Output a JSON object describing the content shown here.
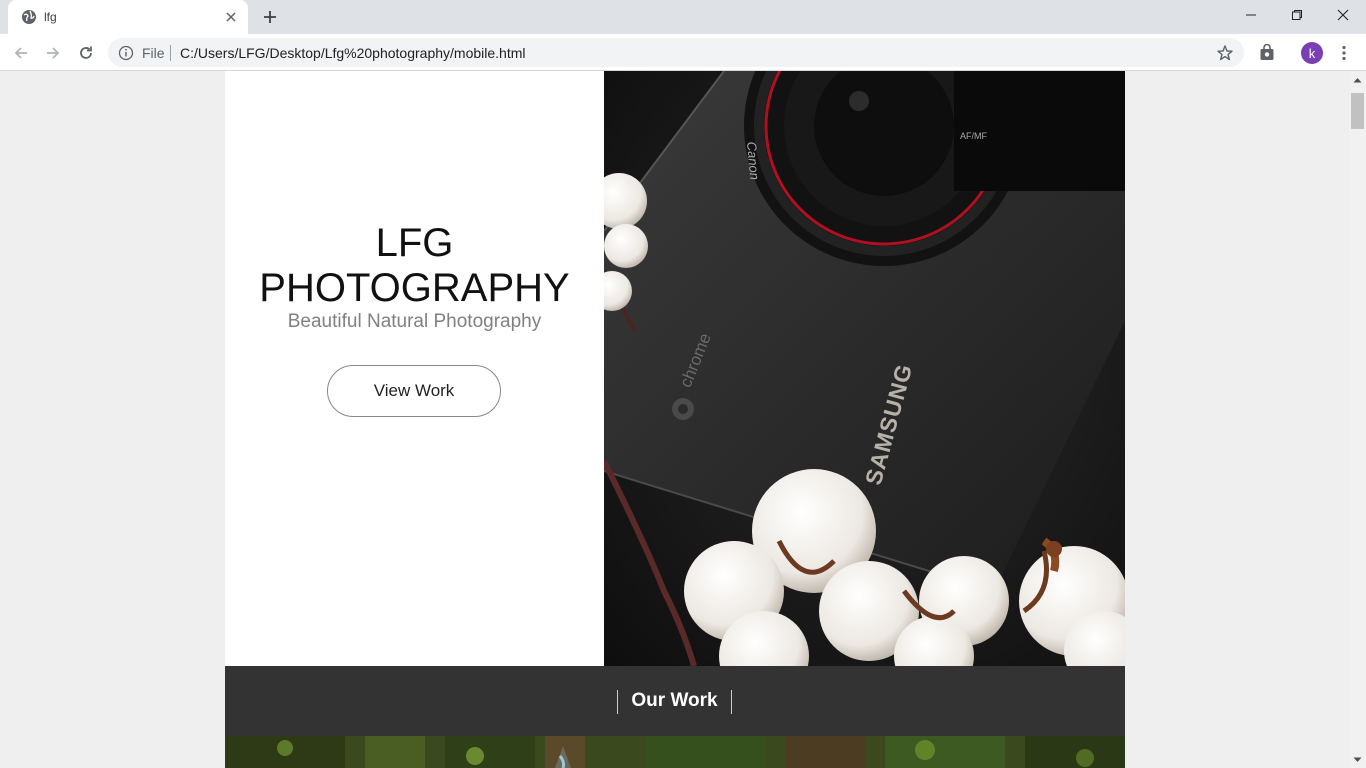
{
  "browser": {
    "tab_title": "lfg",
    "url_scheme_label": "File",
    "url": "C:/Users/LFG/Desktop/Lfg%20photography/mobile.html",
    "profile_initial": "k"
  },
  "hero": {
    "brand_line1": "LFG",
    "brand_line2": "PHOTOGRAPHY",
    "tagline": "Beautiful Natural Photography",
    "cta_label": "View Work",
    "photo_text_camera": "Canon",
    "photo_text_laptop_brand": "SAMSUNG",
    "photo_text_laptop_os": "chrome",
    "photo_text_lens": "AF/MF"
  },
  "sections": {
    "work_title": "Our Work"
  },
  "colors": {
    "page_bg": "#efefef",
    "hero_bg": "#ffffff",
    "section_bar": "#333333",
    "avatar": "#7b3fb4",
    "tagline": "#808080"
  },
  "icons": [
    "globe-icon",
    "close-icon",
    "plus-icon",
    "minimize-icon",
    "restore-icon",
    "back-icon",
    "forward-icon",
    "reload-icon",
    "info-icon",
    "star-icon",
    "extension-icon",
    "menu-icon"
  ]
}
